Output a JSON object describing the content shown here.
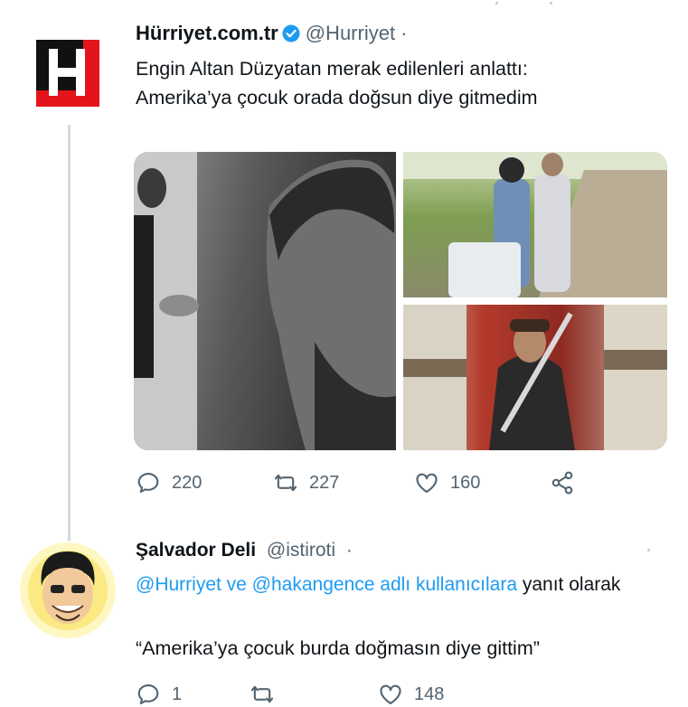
{
  "tweet1": {
    "author_name": "Hürriyet.com.tr",
    "handle": "@Hurriyet",
    "separator": "·",
    "text_line1": "Engin Altan Düzyatan merak edilenleri anlattı:",
    "text_line2": "Amerika’ya çocuk orada doğsun diye gitmedim",
    "reply_count": "220",
    "retweet_count": "227",
    "like_count": "160",
    "logo_letter": "H"
  },
  "tweet2": {
    "author_name": "Şalvador Deli",
    "handle": "@istiroti",
    "separator": "·",
    "reply_to_link": "@Hurriyet ve @hakangence adlı kullanıcılara",
    "reply_to_suffix": "yanıt olarak",
    "text": "“Amerika’ya çocuk burda doğmasın diye gittim”",
    "reply_count": "1",
    "like_count": "148"
  },
  "icons": {
    "reply": "reply-icon",
    "retweet": "retweet-icon",
    "like": "heart-icon",
    "share": "share-icon",
    "verified": "verified-badge-icon"
  },
  "colors": {
    "link": "#1d9bf0",
    "secondary_text": "#536471",
    "logo_red": "#e3141b"
  }
}
